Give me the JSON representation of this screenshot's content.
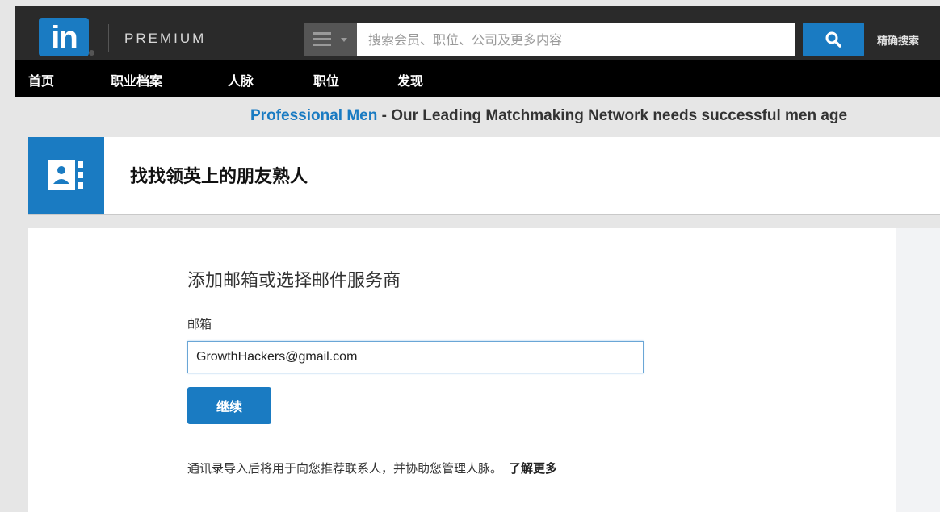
{
  "header": {
    "logo_text": "in",
    "brand": "PREMIUM",
    "search": {
      "placeholder": "搜索会员、职位、公司及更多内容"
    },
    "advanced_search": "精确搜索",
    "icons": {
      "menu": "menu-icon",
      "search": "search-icon"
    }
  },
  "nav": {
    "items": [
      {
        "label": "首页"
      },
      {
        "label": "职业档案"
      },
      {
        "label": "人脉"
      },
      {
        "label": "职位"
      },
      {
        "label": "发现"
      }
    ]
  },
  "promo": {
    "link": "Professional Men",
    "text": " - Our Leading Matchmaking Network needs successful men age"
  },
  "page": {
    "title": "找找领英上的朋友熟人",
    "title_icon": "address-book-icon"
  },
  "form": {
    "heading": "添加邮箱或选择邮件服务商",
    "email_label": "邮箱",
    "email_value": "GrowthHackers@gmail.com",
    "continue_label": "继续",
    "note": "通讯录导入后将用于向您推荐联系人，并协助您管理人脉。",
    "learn_more": "了解更多"
  },
  "colors": {
    "brand_blue": "#1a7bc2",
    "header_bg": "#2a2a2a",
    "nav_bg": "#000000"
  }
}
